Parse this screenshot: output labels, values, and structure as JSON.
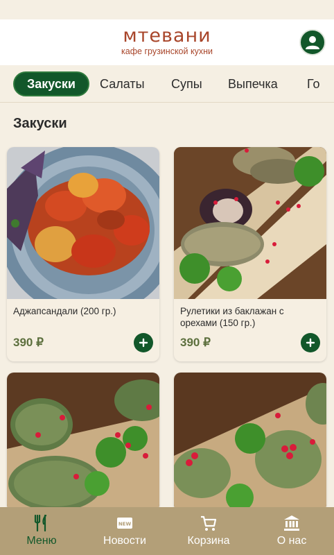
{
  "header": {
    "brand_name": "мтевани",
    "brand_sub": "кафе грузинской кухни",
    "profile_icon": "user-avatar-icon"
  },
  "categories": [
    {
      "label": "Закуски",
      "active": true
    },
    {
      "label": "Салаты"
    },
    {
      "label": "Супы"
    },
    {
      "label": "Выпечка"
    },
    {
      "label": "Го"
    }
  ],
  "section": {
    "title": "Закуски"
  },
  "products": [
    {
      "name": "Аджапсандали (200 гр.)",
      "price": "390 ₽"
    },
    {
      "name": "Рулетики из баклажан с орехами (150 гр.)",
      "price": "390 ₽"
    },
    {
      "name": "",
      "price": ""
    },
    {
      "name": "",
      "price": ""
    }
  ],
  "bottom_nav": [
    {
      "label": "Меню",
      "icon": "fork-knife-icon",
      "active": true
    },
    {
      "label": "Новости",
      "icon": "new-badge-icon"
    },
    {
      "label": "Корзина",
      "icon": "cart-icon"
    },
    {
      "label": "О нас",
      "icon": "bank-building-icon"
    }
  ],
  "colors": {
    "accent_green": "#12572a",
    "brand_red": "#a8452a",
    "price_olive": "#5c6f3d",
    "background": "#f5efe3",
    "nav_background": "#b39f78"
  }
}
